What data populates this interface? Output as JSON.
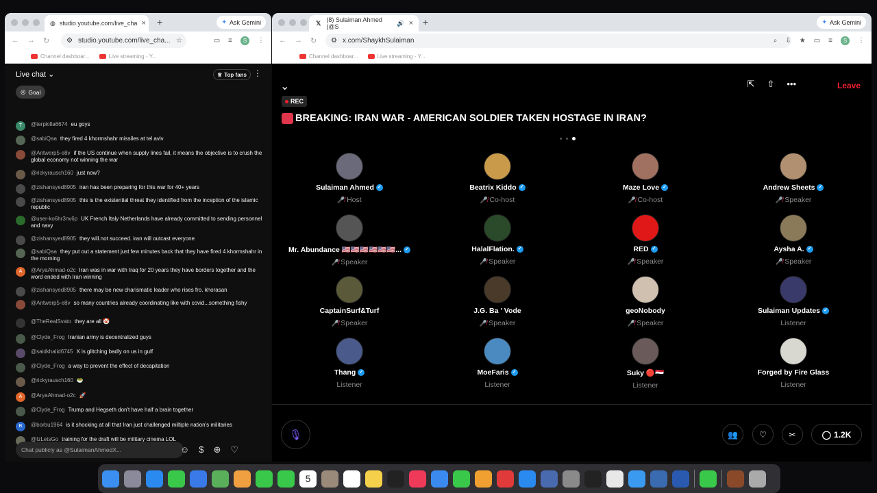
{
  "yt_window": {
    "tab_title": "studio.youtube.com/live_cha",
    "url": "studio.youtube.com/live_cha...",
    "ask_gemini": "Ask Gemini",
    "profile_initial": "S",
    "bookmarks": [
      "Channel dashboar...",
      "Live streaming - Y..."
    ],
    "chat_title": "Live chat",
    "top_fans": "Top fans",
    "goal": "Goal",
    "messages": [
      {
        "author": "@terpkilla6674",
        "text": "eu goys",
        "color": "#3a8a6a",
        "initial": "T"
      },
      {
        "author": "@sabiQaa",
        "text": "they fired 4 khormshahr missiles at tel aviv",
        "color": "#556655",
        "initial": ""
      },
      {
        "author": "@Antwerp5-e8v",
        "text": "if the US continue when supply lines fail, it means the objective is to crush the global economy not winning the war",
        "color": "#8a4a3a",
        "initial": ""
      },
      {
        "author": "@rickyrausch160",
        "text": "just now?",
        "color": "#6a5a4a",
        "initial": ""
      },
      {
        "author": "@zishansyed8905",
        "text": "iran has been preparing for this war for 40+ years",
        "color": "#4a4a4a",
        "initial": ""
      },
      {
        "author": "@zishansyed8905",
        "text": "this is the existential threat they identified from the inception of the islamic republic",
        "color": "#4a4a4a",
        "initial": ""
      },
      {
        "author": "@user-ko6hr3nv6p",
        "text": "UK French Italy Netherlands have already committed to sending personnel and navy",
        "color": "#2a6a2a",
        "initial": ""
      },
      {
        "author": "@zishansyed8905",
        "text": "they will.not succeed. iran will outcast everyone",
        "color": "#4a4a4a",
        "initial": ""
      },
      {
        "author": "@sabiQaa",
        "text": "they put out a statement just few minutes back that they have fired 4 khormshahr in the morning",
        "color": "#556655",
        "initial": ""
      },
      {
        "author": "@AryaAhmad-o2c",
        "text": "Iran was in war with Iraq for 20 years they have borders together and the word ended with Iran winning",
        "color": "#e0662a",
        "initial": "A"
      },
      {
        "author": "@zishansyed8905",
        "text": "there may be new charismatic leader who rises fro. khorasan",
        "color": "#4a4a4a",
        "initial": ""
      },
      {
        "author": "@Antwerp5-e8v",
        "text": "so many countries already coordinating like with covid...something fishy",
        "color": "#8a4a3a",
        "initial": ""
      },
      {
        "author": "@TheRealSvato",
        "text": "they are all 🤡",
        "color": "#333333",
        "initial": ""
      },
      {
        "author": "@Clyde_Frog",
        "text": "Iranian army is decentralized guys",
        "color": "#4a5a4a",
        "initial": ""
      },
      {
        "author": "@saidkhalid6745",
        "text": "X is glitching badly on us in gulf",
        "color": "#5a4a6a",
        "initial": ""
      },
      {
        "author": "@Clyde_Frog",
        "text": "a way to prevent the effect of decapitation",
        "color": "#4a5a4a",
        "initial": ""
      },
      {
        "author": "@rickyrausch160",
        "text": "🥗",
        "color": "#6a5a4a",
        "initial": ""
      },
      {
        "author": "@AryaAhmad-o2c",
        "text": "🚀",
        "color": "#e0662a",
        "initial": "A"
      },
      {
        "author": "@Clyde_Frog",
        "text": "Trump and Hegseth don't have half a brain together",
        "color": "#4a5a4a",
        "initial": ""
      },
      {
        "author": "@borbu1964",
        "text": "is it shocking at all that Iran just challenged miltiple nation's militaries",
        "color": "#2a6ad0",
        "initial": "B"
      },
      {
        "author": "@IzLetsGo",
        "text": "training for the draft will be military cinema LOL",
        "color": "#6a6a5a",
        "initial": ""
      }
    ],
    "input_placeholder": "Chat publicly as @SulaimanAhmedX..."
  },
  "x_window": {
    "tab_title": "(8) Sulaiman Ahmed (@S",
    "url": "x.com/ShaykhSulaiman",
    "ask_gemini": "Ask Gemini",
    "profile_initial": "S",
    "bookmarks": [
      "Channel dashboar...",
      "Live streaming - Y..."
    ],
    "leave": "Leave",
    "rec": "REC",
    "title": "BREAKING: IRAN WAR - AMERICAN SOLDIER TAKEN HOSTAGE IN IRAN?",
    "participants": [
      {
        "name": "Sulaiman Ahmed",
        "verified": true,
        "role": "Host",
        "mic": true,
        "avatar": "#6a6a7a"
      },
      {
        "name": "Beatrix Kiddo",
        "verified": true,
        "role": "Co-host",
        "mic": true,
        "avatar": "#c89a4a"
      },
      {
        "name": "Maze Love",
        "verified": true,
        "role": "Co-host",
        "mic": true,
        "avatar": "#a07060"
      },
      {
        "name": "Andrew Sheets",
        "verified": true,
        "role": "Speaker",
        "mic": true,
        "avatar": "#b09070"
      },
      {
        "name": "Mr. Abundance 🇺🇸🇺🇸🇺🇸🇺🇸🇺🇸🇺🇸...",
        "verified": true,
        "role": "Speaker",
        "mic": true,
        "avatar": "#555555"
      },
      {
        "name": "HalalFlation.",
        "verified": true,
        "role": "Speaker",
        "mic": true,
        "avatar": "#2a4a2a"
      },
      {
        "name": "RED",
        "verified": true,
        "role": "Speaker",
        "mic": true,
        "avatar": "#e01818"
      },
      {
        "name": "Aysha A.",
        "verified": true,
        "role": "Speaker",
        "mic": true,
        "avatar": "#8a7a5a"
      },
      {
        "name": "CaptainSurf&Turf",
        "verified": false,
        "role": "Speaker",
        "mic": true,
        "avatar": "#5a5a3a"
      },
      {
        "name": "J.G. Ba ' Vode",
        "verified": false,
        "role": "Speaker",
        "mic": true,
        "avatar": "#4a3a2a"
      },
      {
        "name": "geoNobody",
        "verified": false,
        "role": "Speaker",
        "mic": true,
        "avatar": "#d0c0b0"
      },
      {
        "name": "Sulaiman Updates",
        "verified": true,
        "role": "Listener",
        "mic": false,
        "avatar": "#3a3a6a"
      },
      {
        "name": "Thang",
        "verified": true,
        "role": "Listener",
        "mic": false,
        "avatar": "#4a5a8a"
      },
      {
        "name": "MoeFaris",
        "verified": true,
        "role": "Listener",
        "mic": false,
        "avatar": "#4a8ac0"
      },
      {
        "name": "Suky 🔴🇾🇪",
        "verified": false,
        "role": "Listener",
        "mic": false,
        "avatar": "#6a5a5a"
      },
      {
        "name": "Forged by Fire Glass",
        "verified": false,
        "role": "Listener",
        "mic": false,
        "avatar": "#d8d8d0"
      }
    ],
    "comment_count": "1.2K"
  },
  "dock": {
    "apps": [
      "finder-icon",
      "launchpad-icon",
      "safari-icon",
      "messages-icon",
      "mail-icon",
      "maps-icon",
      "photos-icon",
      "facetime-icon",
      "phone-icon",
      "calendar-icon",
      "contacts-icon",
      "reminders-icon",
      "notes-icon",
      "appletv-icon",
      "music-icon",
      "keynote-icon",
      "numbers-icon",
      "pages-icon",
      "testflight-icon",
      "appstore-icon",
      "xcode-icon",
      "settings-icon",
      "clock-icon",
      "chrome-icon",
      "screensharing-icon",
      "finder2-icon",
      "quicktime-icon",
      "whatsapp-icon",
      "photobooth-icon",
      "trash-icon"
    ],
    "colors": [
      "#3b8ff0",
      "#8a8a9a",
      "#2a8af0",
      "#3ac84a",
      "#3a7ae8",
      "#5ab05a",
      "#f0a040",
      "#3ac84a",
      "#3ac84a",
      "#ffffff",
      "#9a8a7a",
      "#ffffff",
      "#f5d04a",
      "#222222",
      "#f03a5a",
      "#3a8af0",
      "#3ac84a",
      "#f0a030",
      "#e03a3a",
      "#2a8af0",
      "#4a6ab0",
      "#8a8a8a",
      "#222222",
      "#e8e8e8",
      "#3a9af0",
      "#3a6ab0",
      "#2a5ab0",
      "#3ac84a",
      "#8a4a2a",
      "#aaaaaa"
    ],
    "calendar_day": "5"
  }
}
